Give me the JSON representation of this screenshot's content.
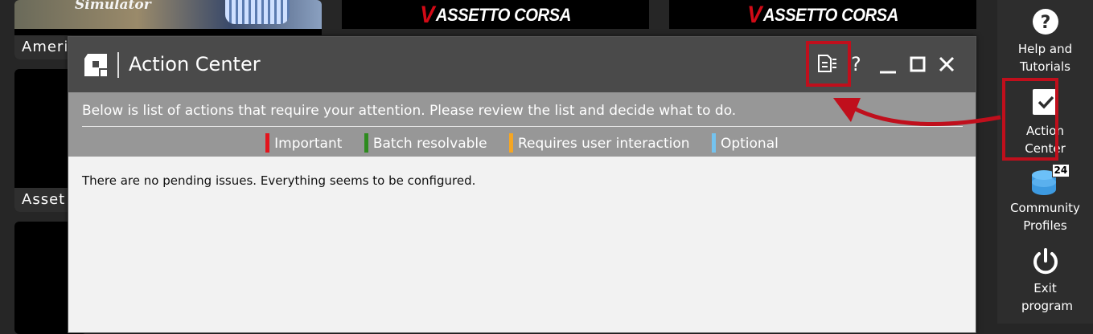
{
  "background_tiles": {
    "tile1_label": "Ameri",
    "tile1_banner_text": "Simulator",
    "tile2_label": "Asset",
    "ac_logo_text": "ASSETTO CORSA"
  },
  "sidebar": {
    "help": {
      "label": "Help and Tutorials",
      "icon": "question-icon"
    },
    "action_center": {
      "label": "Action Center",
      "icon": "checkbox-icon"
    },
    "community_profiles": {
      "label": "Community Profiles",
      "icon": "database-icon",
      "badge": "24"
    },
    "exit": {
      "label": "Exit program",
      "icon": "power-icon"
    }
  },
  "modal": {
    "title": "Action Center",
    "info_text": "Below is list of actions that require your attention. Please review the list and decide what to do.",
    "legend": [
      {
        "label": "Important",
        "color": "#e3141d"
      },
      {
        "label": "Batch resolvable",
        "color": "#2e8b1f"
      },
      {
        "label": "Requires user interaction",
        "color": "#f5a623"
      },
      {
        "label": "Optional",
        "color": "#74c3ef"
      }
    ],
    "empty_message": "There are no pending issues. Everything seems to be configured.",
    "help_glyph": "?"
  },
  "colors": {
    "highlight": "#c00f1c",
    "titlebar": "#4a4a4a",
    "info_bar": "#979797"
  }
}
